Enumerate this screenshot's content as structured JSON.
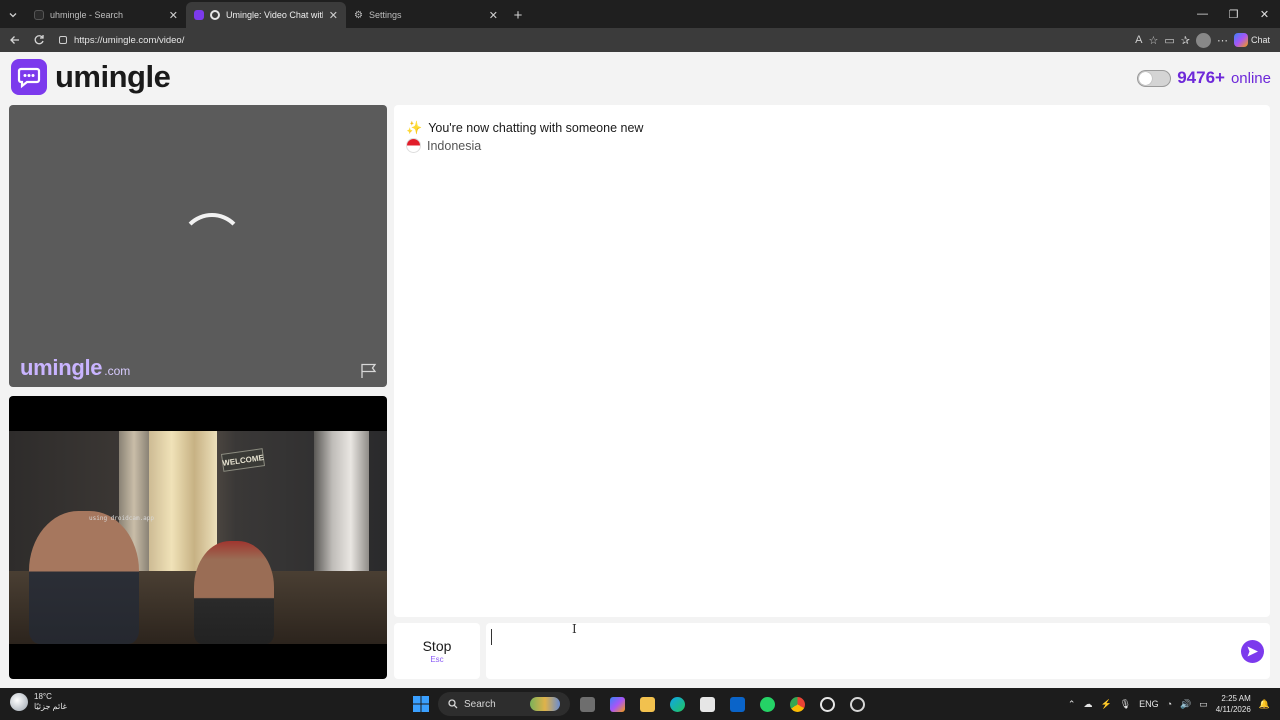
{
  "browser": {
    "tabs": [
      {
        "title": "uhmingle - Search",
        "active": false
      },
      {
        "title": "Umingle: Video Chat with Str",
        "active": true
      },
      {
        "title": "Settings",
        "active": false
      }
    ],
    "url": "https://umingle.com/video/",
    "copilot_label": "Chat"
  },
  "site": {
    "logo_text": "umingle",
    "online_count": "9476+",
    "online_label": "online"
  },
  "stranger_video": {
    "watermark_main": "umingle",
    "watermark_tld": ".com"
  },
  "self_video": {
    "sign_text": "WELCOME",
    "overlay_text": "using droidcam.app"
  },
  "chat": {
    "messages": [
      {
        "icon": "sparkles-icon",
        "text": "You're now chatting with someone new"
      },
      {
        "icon": "indonesia-flag-icon",
        "text": "Indonesia"
      }
    ],
    "stop_label": "Stop",
    "stop_shortcut": "Esc",
    "input_value": "",
    "brand_color": "#7c3aed"
  },
  "taskbar": {
    "temperature": "18°C",
    "weather_sub": "غائم جزئيًا",
    "search_label": "Search",
    "language": "ENG",
    "time": "2:25 AM",
    "date": "4/11/2026"
  }
}
